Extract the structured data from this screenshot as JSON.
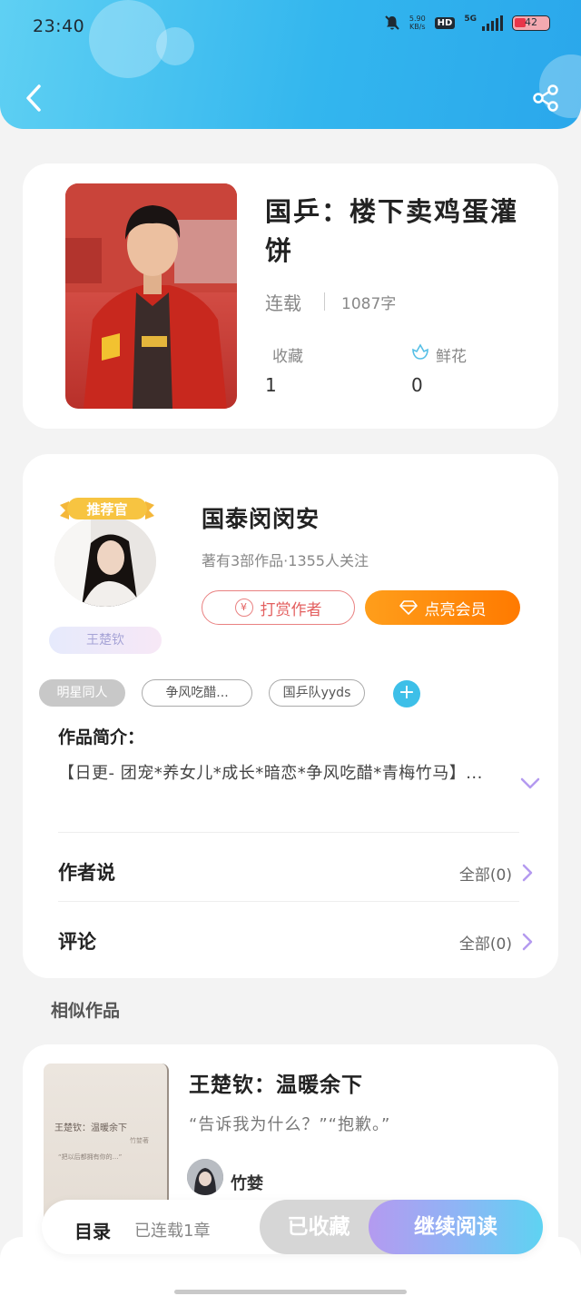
{
  "status_bar": {
    "time": "23:40",
    "net_speed": "5.90",
    "net_unit": "KB/s",
    "hd_label": "HD",
    "signal_label": "5G",
    "battery": "42"
  },
  "book": {
    "title": "国乒：楼下卖鸡蛋灌饼",
    "status": "连载",
    "word_count": "1087字",
    "favorites_label": "收藏",
    "favorites_value": "1",
    "flowers_label": "鲜花",
    "flowers_value": "0"
  },
  "author": {
    "badge": "推荐官",
    "name_tag": "王楚钦",
    "name": "国泰闵闵安",
    "meta": "著有3部作品·1355人关注",
    "tip_label": "打赏作者",
    "tip_icon_text": "¥",
    "vip_label": "点亮会员"
  },
  "tags": [
    "明星同人",
    "争风吃醋...",
    "国乒队yyds"
  ],
  "tag_add_label": "+",
  "intro": {
    "title": "作品简介：",
    "text": "【日更- 团宠*养女儿*成长*暗恋*争风吃醋*青梅竹马】..."
  },
  "author_says": {
    "label": "作者说",
    "right": "全部(0)"
  },
  "comments": {
    "label": "评论",
    "right": "全部(0)"
  },
  "similar": {
    "section_title": "相似作品",
    "items": [
      {
        "title": "王楚钦：温暖余下",
        "desc": "“告诉我为什么？”“抱歉。”",
        "author": "竹婪",
        "cover_title": "王楚钦：温暖余下",
        "cover_author": "竹婪著",
        "cover_quote": "“把以后都拥有你的…”"
      }
    ]
  },
  "bottom_bar": {
    "toc_label": "目录",
    "toc_count": "已连载1章",
    "fav_label": "已收藏",
    "read_label": "继续阅读"
  },
  "colors": {
    "header_start": "#5fd0f3",
    "header_end": "#2aa7eb",
    "vip_orange": "#ff7a00",
    "tip_red": "#e35f5f",
    "accent_purple": "#b49af0"
  }
}
